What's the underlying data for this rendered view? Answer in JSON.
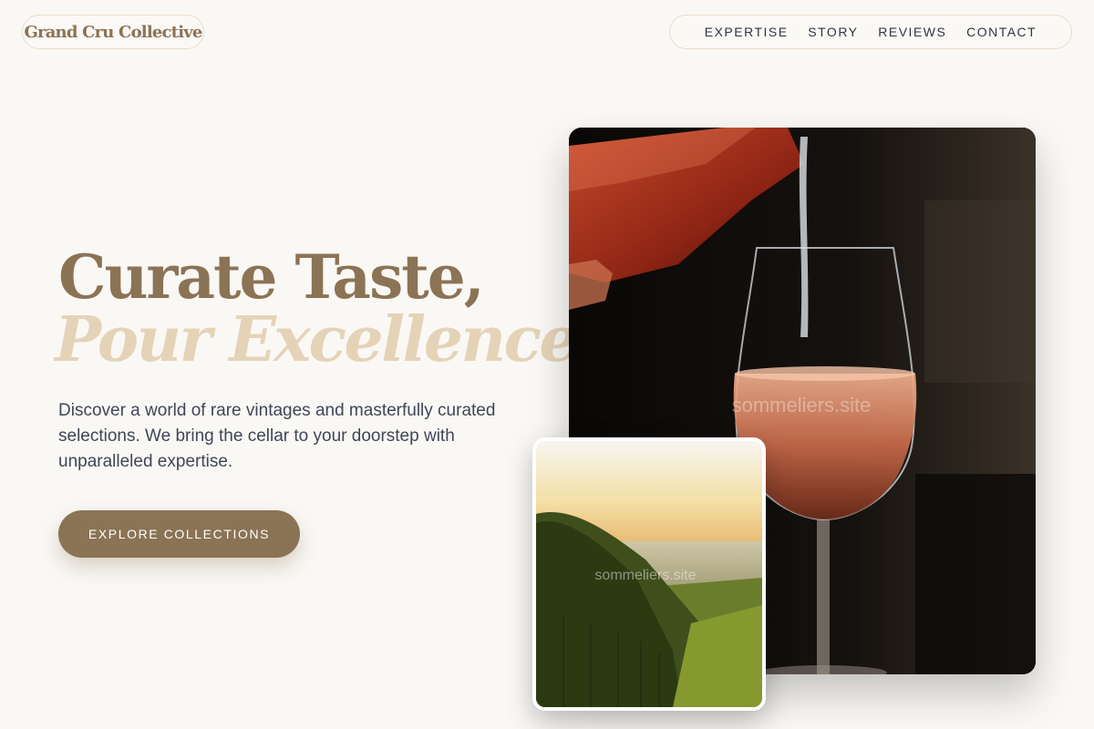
{
  "brand": {
    "name": "Grand Cru Collective"
  },
  "nav": {
    "items": [
      {
        "label": "EXPERTISE"
      },
      {
        "label": "STORY"
      },
      {
        "label": "REVIEWS"
      },
      {
        "label": "CONTACT"
      }
    ]
  },
  "hero": {
    "headline_line1": "Curate Taste,",
    "headline_line2": "Pour Excellence.",
    "description": "Discover a world of rare vintages and masterfully curated selections. We bring the cellar to your doorstep with unparalleled expertise.",
    "cta_label": "EXPLORE COLLECTIONS"
  },
  "images": {
    "main_watermark": "sommeliers.site",
    "inset_watermark": "sommeliers.site"
  },
  "colors": {
    "background": "#faf8f5",
    "accent": "#8b7355",
    "accent_light": "#e5d3b8",
    "text": "#3f4656"
  }
}
